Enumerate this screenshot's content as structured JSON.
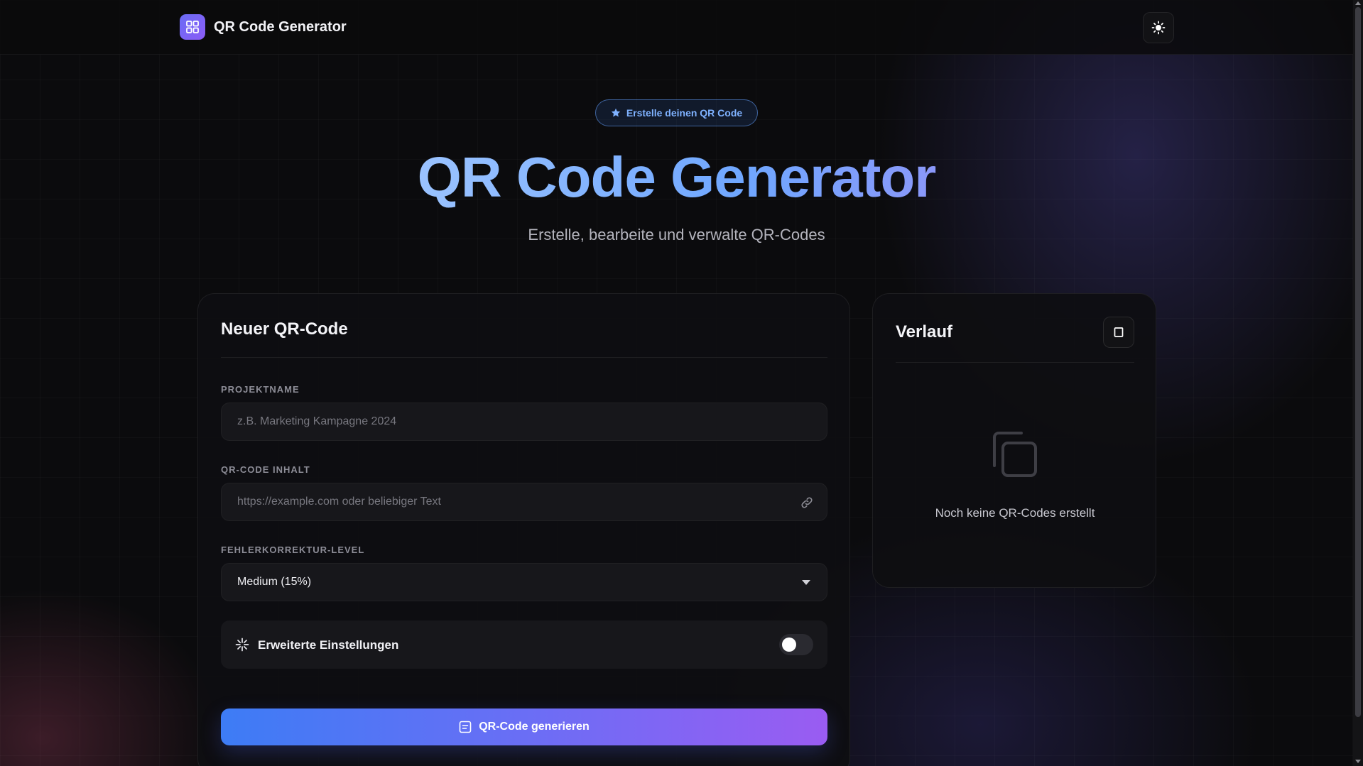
{
  "header": {
    "app_title": "QR Code Generator",
    "logo_icon": "qr-grid-icon",
    "theme_toggle_icon": "sun-icon"
  },
  "hero": {
    "badge_label": "Erstelle deinen QR Code",
    "badge_icon": "star-icon",
    "title_part1": "QR Code Generator",
    "subtitle": "Erstelle, bearbeite und verwalte QR-Codes"
  },
  "form": {
    "title": "Neuer QR-Code",
    "project_name_label": "PROJEKTNAME",
    "project_name_placeholder": "z.B. Marketing Kampagne 2024",
    "project_name_value": "",
    "content_label": "QR-CODE INHALT",
    "content_placeholder": "https://example.com oder beliebiger Text",
    "content_value": "",
    "content_icon": "link-icon",
    "error_level_label": "FEHLERKORREKTUR-LEVEL",
    "error_level_selected": "Medium (15%)",
    "advanced_label": "Erweiterte Einstellungen",
    "advanced_icon": "sparkle-icon",
    "advanced_enabled": false,
    "generate_label": "QR-Code generieren",
    "generate_icon": "qr-doc-icon"
  },
  "history": {
    "title": "Verlauf",
    "action_icon": "square-icon",
    "empty_icon": "copy-icon",
    "empty_text": "Noch keine QR-Codes erstellt"
  },
  "colors": {
    "accent_blue": "#3d7cf5",
    "accent_purple": "#9a5cf2",
    "badge_text": "#7fb2ff",
    "background": "#0b0b0d"
  }
}
